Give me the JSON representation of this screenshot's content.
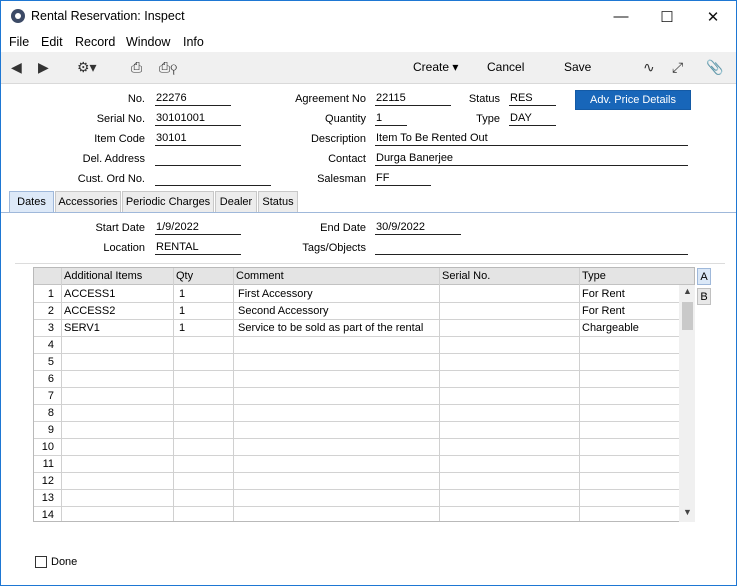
{
  "window": {
    "title": "Rental Reservation: Inspect"
  },
  "menu": [
    "File",
    "Edit",
    "Record",
    "Window",
    "Info"
  ],
  "toolbar": {
    "create": "Create",
    "cancel": "Cancel",
    "save": "Save"
  },
  "form": {
    "no_label": "No.",
    "no": "22276",
    "serial_label": "Serial No.",
    "serial": "30101001",
    "item_label": "Item Code",
    "item": "30101",
    "del_label": "Del. Address",
    "del": "",
    "cust_label": "Cust. Ord No.",
    "cust": "",
    "agreement_label": "Agreement No",
    "agreement": "22115",
    "status_label": "Status",
    "status": "RES",
    "quantity_label": "Quantity",
    "quantity": "1",
    "type_label": "Type",
    "type": "DAY",
    "desc_label": "Description",
    "desc": "Item To Be Rented Out",
    "contact_label": "Contact",
    "contact": "Durga Banerjee",
    "salesman_label": "Salesman",
    "salesman": "FF",
    "adv_button": "Adv. Price Details"
  },
  "tabs": [
    "Dates",
    "Accessories",
    "Periodic Charges",
    "Dealer",
    "Status"
  ],
  "dates": {
    "start_label": "Start Date",
    "start": "1/9/2022",
    "end_label": "End Date",
    "end": "30/9/2022",
    "location_label": "Location",
    "location": "RENTAL",
    "tags_label": "Tags/Objects",
    "tags": ""
  },
  "grid": {
    "headers": [
      "Additional Items",
      "Qty",
      "Comment",
      "Serial No.",
      "Type"
    ],
    "rows": [
      [
        "1",
        "ACCESS1",
        "1",
        "First Accessory",
        "",
        "For Rent"
      ],
      [
        "2",
        "ACCESS2",
        "1",
        "Second Accessory",
        "",
        "For Rent"
      ],
      [
        "3",
        "SERV1",
        "1",
        "Service to be sold as part of the rental",
        "",
        "Chargeable"
      ],
      [
        "4",
        "",
        "",
        "",
        "",
        ""
      ],
      [
        "5",
        "",
        "",
        "",
        "",
        ""
      ],
      [
        "6",
        "",
        "",
        "",
        "",
        ""
      ],
      [
        "7",
        "",
        "",
        "",
        "",
        ""
      ],
      [
        "8",
        "",
        "",
        "",
        "",
        ""
      ],
      [
        "9",
        "",
        "",
        "",
        "",
        ""
      ],
      [
        "10",
        "",
        "",
        "",
        "",
        ""
      ],
      [
        "11",
        "",
        "",
        "",
        "",
        ""
      ],
      [
        "12",
        "",
        "",
        "",
        "",
        ""
      ],
      [
        "13",
        "",
        "",
        "",
        "",
        ""
      ],
      [
        "14",
        "",
        "",
        "",
        "",
        ""
      ]
    ],
    "side_tabs": [
      "A",
      "B"
    ]
  },
  "done_label": "Done"
}
